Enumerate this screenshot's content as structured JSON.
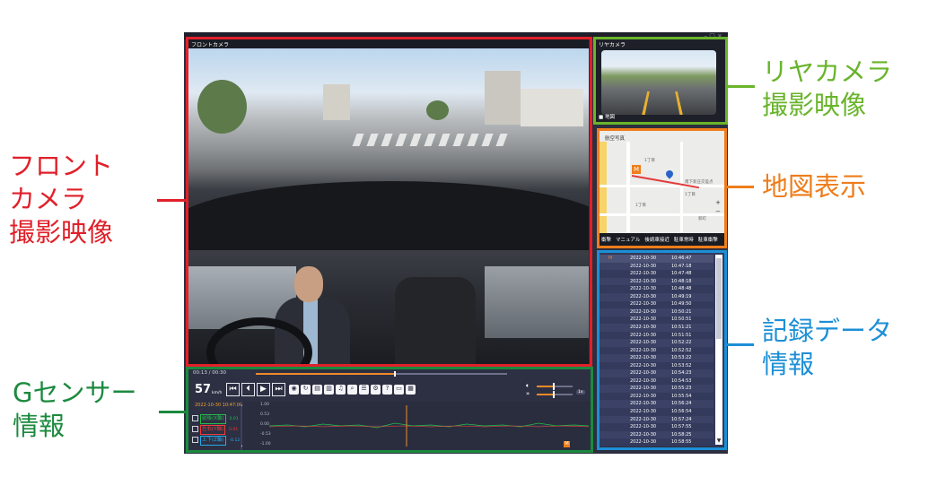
{
  "window": {
    "controls": "– □ ×"
  },
  "front_camera": {
    "label": "フロントカメラ"
  },
  "rear_camera": {
    "label": "リヤカメラ",
    "map_tab": "■ 地図"
  },
  "map": {
    "title": "航空写真",
    "marker": "M",
    "labels": [
      "1丁目",
      "1丁目",
      "1丁目",
      "南下新庄交差点",
      "新町"
    ],
    "zoom_in": "+",
    "zoom_out": "−",
    "tabs": [
      "衝撃",
      "マニュアル",
      "後続車接近",
      "駐車常時",
      "駐車衝撃"
    ]
  },
  "records": {
    "rows": [
      {
        "marker": "M",
        "date": "2022-10-30",
        "time": "10:46:47"
      },
      {
        "marker": "",
        "date": "2022-10-30",
        "time": "10:47:18"
      },
      {
        "marker": "",
        "date": "2022-10-30",
        "time": "10:47:48"
      },
      {
        "marker": "",
        "date": "2022-10-30",
        "time": "10:48:18"
      },
      {
        "marker": "",
        "date": "2022-10-30",
        "time": "10:48:48"
      },
      {
        "marker": "",
        "date": "2022-10-30",
        "time": "10:49:19"
      },
      {
        "marker": "",
        "date": "2022-10-30",
        "time": "10:49:50"
      },
      {
        "marker": "",
        "date": "2022-10-30",
        "time": "10:50:21"
      },
      {
        "marker": "",
        "date": "2022-10-30",
        "time": "10:50:51"
      },
      {
        "marker": "",
        "date": "2022-10-30",
        "time": "10:51:21"
      },
      {
        "marker": "",
        "date": "2022-10-30",
        "time": "10:51:51"
      },
      {
        "marker": "",
        "date": "2022-10-30",
        "time": "10:52:22"
      },
      {
        "marker": "",
        "date": "2022-10-30",
        "time": "10:52:52"
      },
      {
        "marker": "",
        "date": "2022-10-30",
        "time": "10:53:22"
      },
      {
        "marker": "",
        "date": "2022-10-30",
        "time": "10:53:52"
      },
      {
        "marker": "",
        "date": "2022-10-30",
        "time": "10:54:23"
      },
      {
        "marker": "",
        "date": "2022-10-30",
        "time": "10:54:53"
      },
      {
        "marker": "",
        "date": "2022-10-30",
        "time": "10:55:23"
      },
      {
        "marker": "",
        "date": "2022-10-30",
        "time": "10:55:54"
      },
      {
        "marker": "",
        "date": "2022-10-30",
        "time": "10:56:24"
      },
      {
        "marker": "",
        "date": "2022-10-30",
        "time": "10:56:54"
      },
      {
        "marker": "",
        "date": "2022-10-30",
        "time": "10:57:24"
      },
      {
        "marker": "",
        "date": "2022-10-30",
        "time": "10:57:55"
      },
      {
        "marker": "",
        "date": "2022-10-30",
        "time": "10:58:25"
      },
      {
        "marker": "",
        "date": "2022-10-30",
        "time": "10:58:55"
      }
    ],
    "scroll_arrow": "▼"
  },
  "playback": {
    "time": "00:13 / 00:30",
    "seek_progress": 0.55,
    "speed": "57",
    "speed_unit": "km/h",
    "volume_level": 0.45,
    "playback_speed_level": 0.45,
    "speed_badge": "1x",
    "buttons": {
      "first": "⏮",
      "prev": "⏴",
      "play": "▶",
      "next": "⏭"
    }
  },
  "gsensor": {
    "datetime": "2022-10-30 10:47:00",
    "axes": [
      {
        "name": "前後(X軸)",
        "value": "0.01",
        "color": "#1fbf48"
      },
      {
        "name": "左右(Y軸)",
        "value": "0.01",
        "color": "#ee3b3b"
      },
      {
        "name": "上下(Z軸)",
        "value": "-0.12",
        "color": "#27a8e8"
      }
    ],
    "y_ticks": [
      "1.00",
      "0.53",
      "0.00",
      "-0.53",
      "-1.00"
    ]
  },
  "callouts": {
    "front": [
      "フロント",
      "カメラ",
      "撮影映像"
    ],
    "rear": [
      "リヤカメラ",
      "撮影映像"
    ],
    "map": [
      "地図表示"
    ],
    "records": [
      "記録データ",
      "情報"
    ],
    "gsensor": [
      "Gセンサー",
      "情報"
    ]
  },
  "colors": {
    "front": "#e0202a",
    "rear": "#69b42b",
    "map": "#ee7d1b",
    "records": "#1c8fd6",
    "gsensor": "#1b8a3f",
    "app_bg": "#2c2f3e",
    "accent": "#f08a2a"
  }
}
